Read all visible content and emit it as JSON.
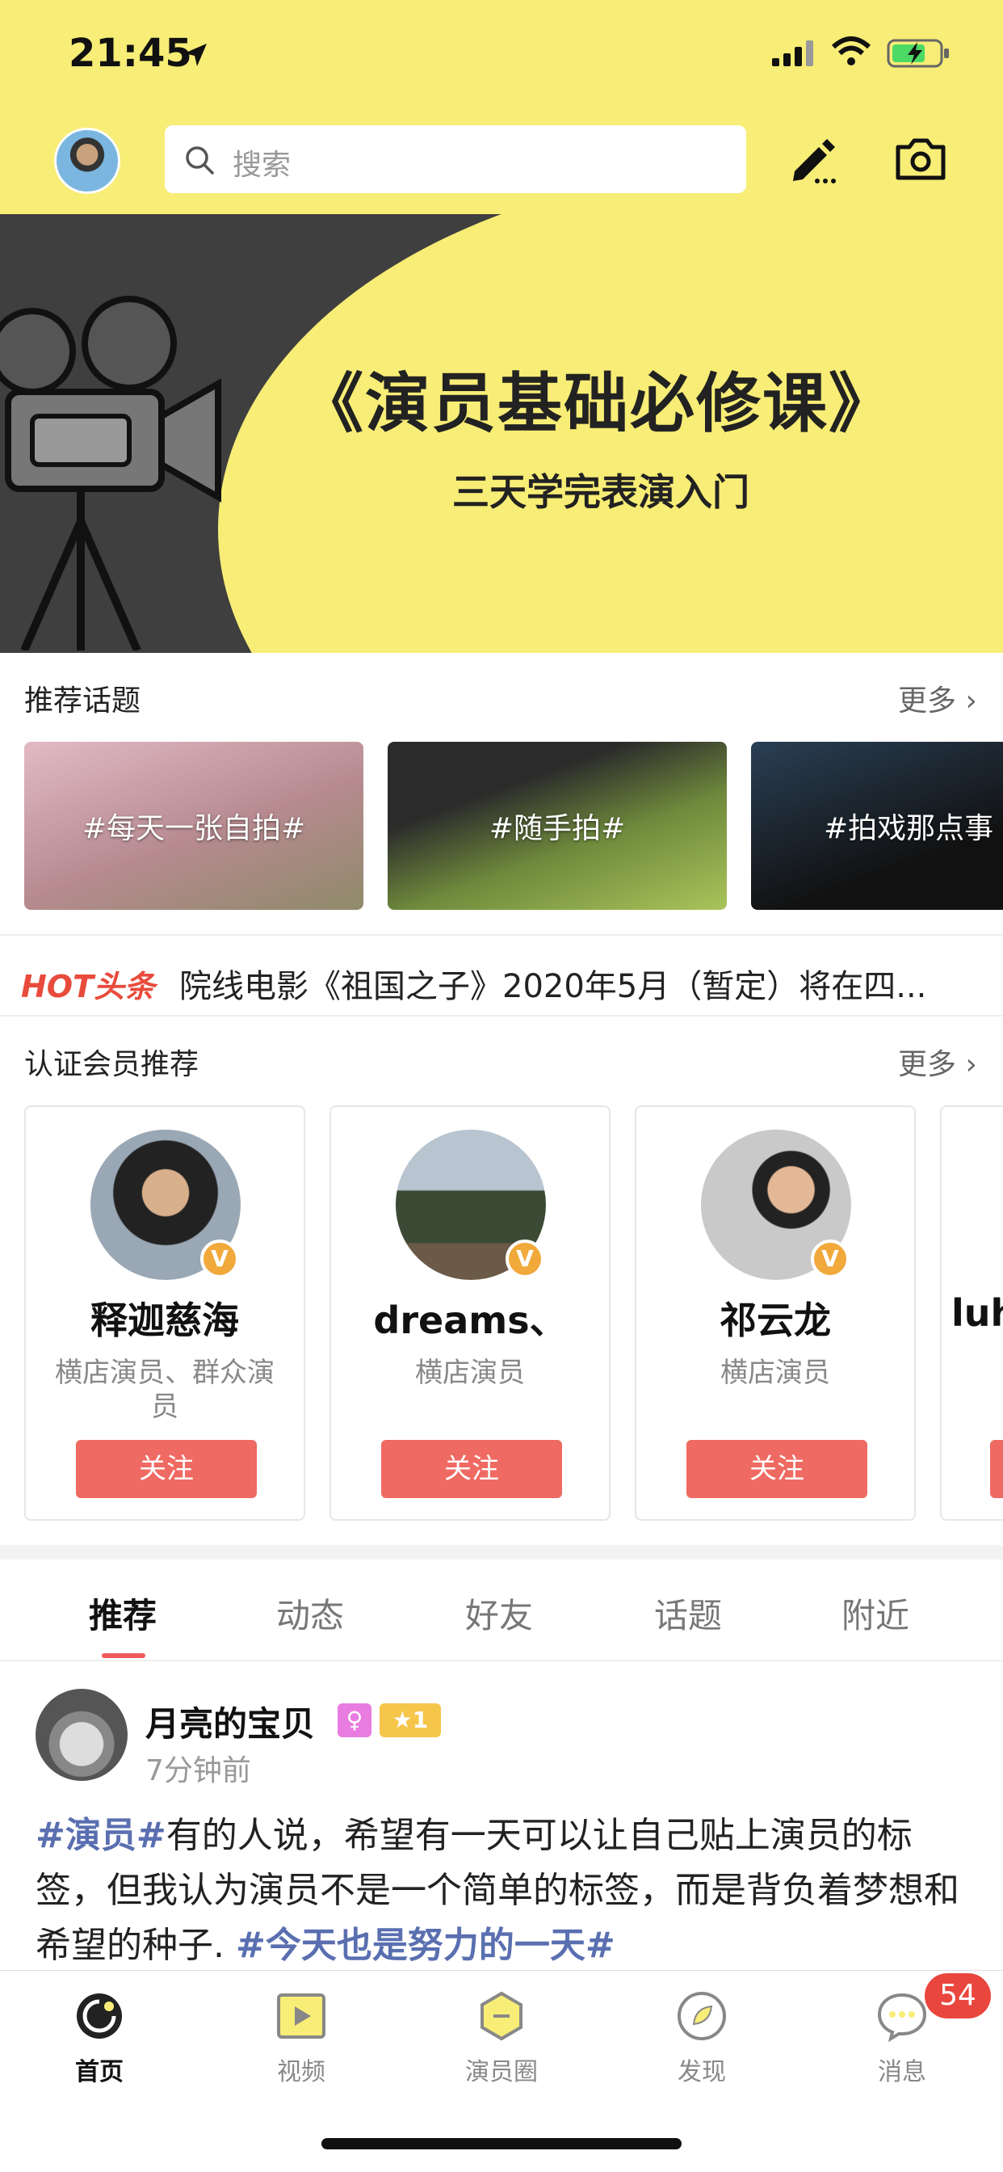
{
  "status_bar": {
    "time": "21:45"
  },
  "header": {
    "search_placeholder": "搜索"
  },
  "banner": {
    "title": "《演员基础必修课》",
    "subtitle": "三天学完表演入门"
  },
  "topics": {
    "title": "推荐话题",
    "more": "更多 ›",
    "items": [
      {
        "label": "#每天一张自拍#",
        "bg": "#c89aa8"
      },
      {
        "label": "#随手拍#",
        "bg": "#6f8a3c"
      },
      {
        "label": "#拍戏那点事",
        "bg": "#1f2c3a"
      }
    ]
  },
  "hot": {
    "logo": "HOT头条",
    "text": "院线电影《祖国之子》2020年5月（暂定）将在四..."
  },
  "members": {
    "title": "认证会员推荐",
    "more": "更多 ›",
    "items": [
      {
        "name": "释迦慈海",
        "role": "横店演员、群众演员",
        "follow": "关注"
      },
      {
        "name": "dreams、",
        "role": "横店演员",
        "follow": "关注"
      },
      {
        "name": "祁云龙",
        "role": "横店演员",
        "follow": "关注"
      },
      {
        "name": "luh",
        "role": "",
        "follow": ""
      }
    ],
    "verified_badge": "V"
  },
  "feed_tabs": [
    "推荐",
    "动态",
    "好友",
    "话题",
    "附近"
  ],
  "post": {
    "user": "月亮的宝贝",
    "female_badge": "♀",
    "level": "★1",
    "time": "7分钟前",
    "tag1": "#演员#",
    "text": "有的人说，希望有一天可以让自己贴上演员的标签，但我认为演员不是一个简单的标签，而是背负着梦想和希望的种子.",
    "tag2": "#今天也是努力的一天#"
  },
  "tabbar": {
    "items": [
      {
        "label": "首页",
        "icon": "home-icon"
      },
      {
        "label": "视频",
        "icon": "video-icon"
      },
      {
        "label": "演员圈",
        "icon": "actor-circle-icon"
      },
      {
        "label": "发现",
        "icon": "discover-icon"
      },
      {
        "label": "消息",
        "icon": "message-icon"
      }
    ],
    "message_badge": "54"
  },
  "colors": {
    "accent_yellow": "#f8ed76",
    "follow_red": "#ef6a62",
    "hashtag_blue": "#5a6fb0"
  }
}
